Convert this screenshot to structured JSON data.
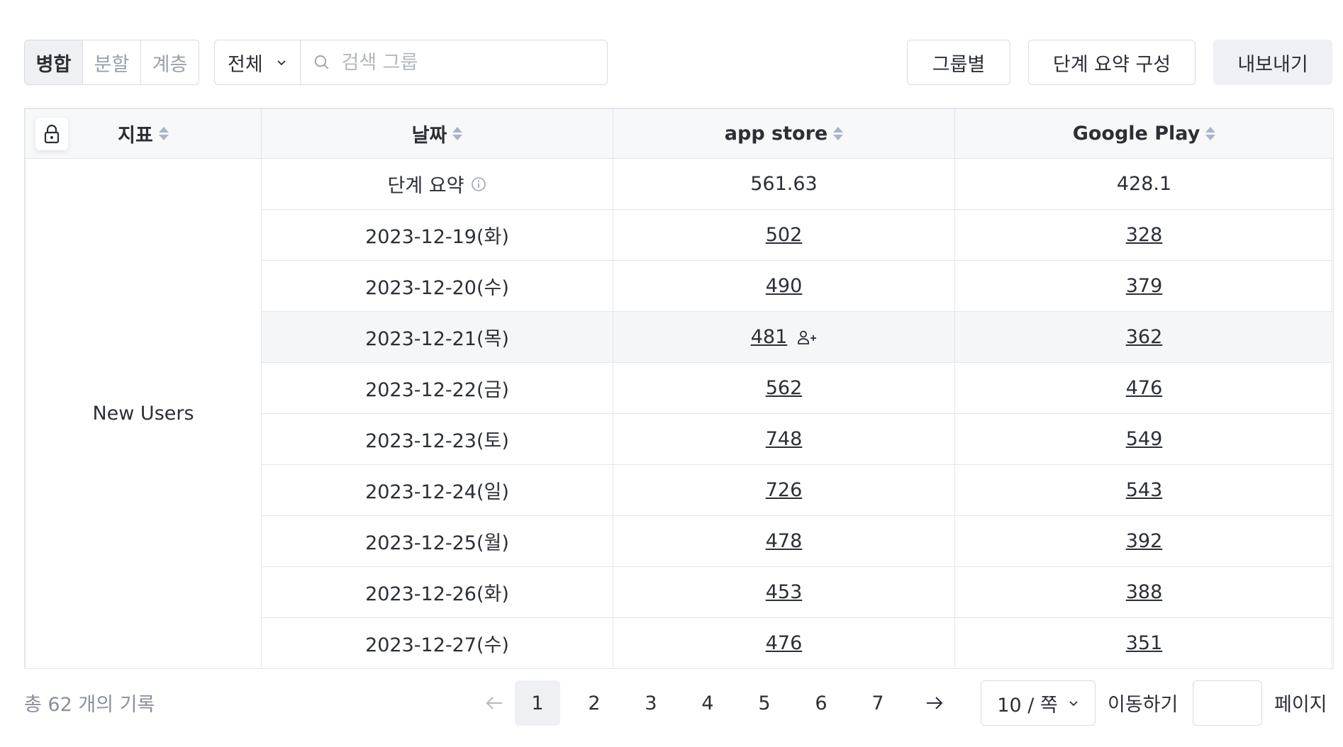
{
  "toolbar": {
    "view_modes": [
      "병합",
      "분할",
      "계층"
    ],
    "active_mode": "병합",
    "scope_select": "전체",
    "search_placeholder": "검색 그룹",
    "group_by_label": "그룹별",
    "configure_summary_label": "단계 요약 구성",
    "export_label": "내보내기"
  },
  "table": {
    "headers": {
      "metric": "지표",
      "date": "날짜",
      "app_store": "app store",
      "google_play": "Google Play"
    },
    "metric_name": "New Users",
    "summary": {
      "label": "단계 요약",
      "app_store": "561.63",
      "google_play": "428.1"
    },
    "rows": [
      {
        "date": "2023-12-19(화)",
        "app_store": "502",
        "google_play": "328"
      },
      {
        "date": "2023-12-20(수)",
        "app_store": "490",
        "google_play": "379"
      },
      {
        "date": "2023-12-21(목)",
        "app_store": "481",
        "google_play": "362"
      },
      {
        "date": "2023-12-22(금)",
        "app_store": "562",
        "google_play": "476"
      },
      {
        "date": "2023-12-23(토)",
        "app_store": "748",
        "google_play": "549"
      },
      {
        "date": "2023-12-24(일)",
        "app_store": "726",
        "google_play": "543"
      },
      {
        "date": "2023-12-25(월)",
        "app_store": "478",
        "google_play": "392"
      },
      {
        "date": "2023-12-26(화)",
        "app_store": "453",
        "google_play": "388"
      },
      {
        "date": "2023-12-27(수)",
        "app_store": "476",
        "google_play": "351"
      }
    ]
  },
  "footer": {
    "total_records": "총 62 개의 기록",
    "pages": [
      "1",
      "2",
      "3",
      "4",
      "5",
      "6",
      "7"
    ],
    "current_page": "1",
    "page_size": "10 / 쪽",
    "goto_label": "이동하기",
    "page_suffix": "페이지"
  },
  "icons": {
    "lock": "lock-icon",
    "search": "search-icon",
    "info": "info-icon",
    "add_user": "add-user-icon",
    "chevron": "chevron-down-icon",
    "prev": "arrow-left-icon",
    "next": "arrow-right-icon"
  }
}
